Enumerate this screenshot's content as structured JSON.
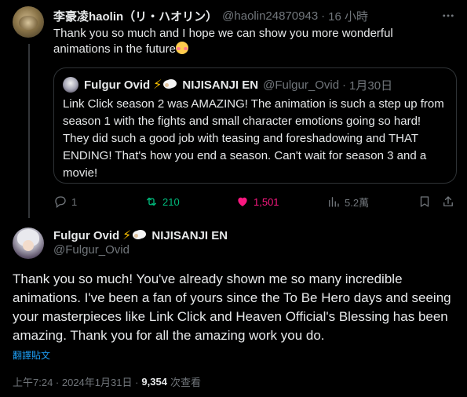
{
  "reply": {
    "author_name": "李豪凌haolin（リ・ハオリン）",
    "handle": "@haolin24870943",
    "separator": "·",
    "time": "16 小時",
    "more_icon": "more-icon",
    "text": "Thank you so much and I hope we can show you more wonderful animations in the future",
    "emoji": "smiling-face-with-hearts-emoji",
    "quote": {
      "author_name": "Fulgur Ovid",
      "org": "NIJISANJI EN",
      "handle": "@Fulgur_Ovid",
      "separator": "·",
      "date": "1月30日",
      "text": "Link Click season 2 was AMAZING! The animation is such a step up from season 1 with the fights and small character emotions going so hard! They did such a good job with teasing and foreshadowing and THAT ENDING! That's how you end a season. Can't wait for season 3 and a movie!"
    },
    "actions": {
      "reply_count": "1",
      "retweet_count": "210",
      "like_count": "1,501",
      "views_count": "5.2萬"
    },
    "colors": {
      "retweet": "#00ba7c",
      "like": "#f91880"
    }
  },
  "main": {
    "author_name": "Fulgur Ovid",
    "org": "NIJISANJI EN",
    "handle": "@Fulgur_Ovid",
    "text": "Thank you so much! You've already shown me so many incredible animations. I've been a fan of yours since the To Be Hero days and seeing your masterpieces like Link Click and Heaven Official's Blessing has been amazing. Thank you for all the amazing work you do.",
    "translate_label": "翻譯貼文",
    "timestamp": "上午7:24 · 2024年1月31日 ·",
    "views_number": "9,354",
    "views_label": "次查看"
  },
  "colors": {
    "background": "#000000",
    "text": "#e7e9ea",
    "muted": "#71767b",
    "link": "#1d9bf0",
    "verified_bolt": "#ffc400"
  }
}
